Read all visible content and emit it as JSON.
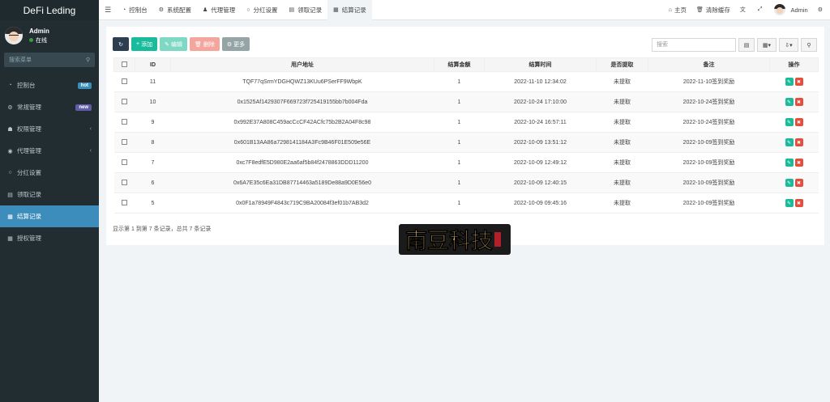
{
  "brand": "DeFi Leding",
  "user": {
    "name": "Admin",
    "status": "在线"
  },
  "sidebar": {
    "search_placeholder": "搜索菜单",
    "items": [
      {
        "label": "控制台",
        "icon": "dashboard-icon",
        "badge": "hot"
      },
      {
        "label": "常规管理",
        "icon": "cogs-icon",
        "badge": "new"
      },
      {
        "label": "权限管理",
        "icon": "group-icon",
        "chevron": true
      },
      {
        "label": "代理管理",
        "icon": "user-circle-icon",
        "chevron": true
      },
      {
        "label": "分红设置",
        "icon": "circle-icon"
      },
      {
        "label": "领取记录",
        "icon": "list-icon"
      },
      {
        "label": "结算记录",
        "icon": "table-icon",
        "active": true
      },
      {
        "label": "授权管理",
        "icon": "table-icon"
      }
    ]
  },
  "tabs": [
    {
      "label": "控制台",
      "icon": "dashboard-icon"
    },
    {
      "label": "系统配置",
      "icon": "gear-icon"
    },
    {
      "label": "代理管理",
      "icon": "user-icon"
    },
    {
      "label": "分红设置",
      "icon": "circle-icon"
    },
    {
      "label": "领取记录",
      "icon": "list-icon"
    },
    {
      "label": "结算记录",
      "icon": "table-icon",
      "active": true
    }
  ],
  "navright": {
    "home": "主页",
    "clear": "清除缓存",
    "admin": "Admin"
  },
  "toolbar": {
    "add": "添加",
    "edit": "编辑",
    "del": "删除",
    "more": "更多"
  },
  "search": {
    "placeholder": "搜索"
  },
  "table": {
    "headers": [
      "ID",
      "用户地址",
      "结算金额",
      "结算时间",
      "是否提取",
      "备注",
      "操作"
    ],
    "rows": [
      {
        "id": "11",
        "address": "TQF77qSrmYDGHQWZ13KUu6PSerFF9WbpK",
        "amount": "1",
        "time": "2022-11-10 12:34:02",
        "withdrawn": "未提取",
        "remark": "2022-11-10签到奖励"
      },
      {
        "id": "10",
        "address": "0x1525Af1429307F669723f725419155bb7b004Fda",
        "amount": "1",
        "time": "2022-10-24 17:10:00",
        "withdrawn": "未提取",
        "remark": "2022-10-24签到奖励"
      },
      {
        "id": "9",
        "address": "0x992E37A808C459acCcCF42ACfc75b2B2A04F8c98",
        "amount": "1",
        "time": "2022-10-24 16:57:11",
        "withdrawn": "未提取",
        "remark": "2022-10-24签到奖励"
      },
      {
        "id": "8",
        "address": "0x601B13AA86a7298141184A3Fc9B46F01E509e56E",
        "amount": "1",
        "time": "2022-10-09 13:51:12",
        "withdrawn": "未提取",
        "remark": "2022-10-09签到奖励"
      },
      {
        "id": "7",
        "address": "0xc7F8edfE5D980E2aa6af5b84f2478863DDD11200",
        "amount": "1",
        "time": "2022-10-09 12:49:12",
        "withdrawn": "未提取",
        "remark": "2022-10-09签到奖励"
      },
      {
        "id": "6",
        "address": "0x6A7E35c6Ea31DB87714463a5189De88a9D0E56e0",
        "amount": "1",
        "time": "2022-10-09 12:40:15",
        "withdrawn": "未提取",
        "remark": "2022-10-09签到奖励"
      },
      {
        "id": "5",
        "address": "0x0F1a78949F4843c719C9BA20084f3ef01b7AB3d2",
        "amount": "1",
        "time": "2022-10-09 09:45:16",
        "withdrawn": "未提取",
        "remark": "2022-10-09签到奖励"
      }
    ]
  },
  "pager": "显示第 1 到第 7 条记录，总共 7 条记录",
  "watermark": "南豆科技"
}
